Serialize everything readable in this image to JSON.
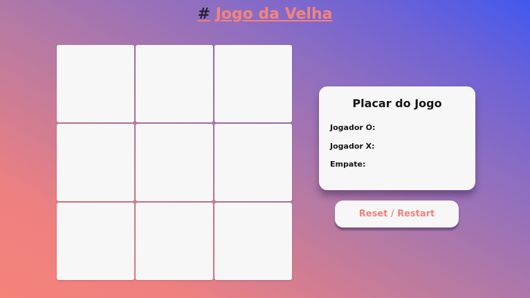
{
  "header": {
    "hash": "#",
    "title": "Jogo da Velha"
  },
  "board": {
    "cells": [
      "",
      "",
      "",
      "",
      "",
      "",
      "",
      "",
      ""
    ]
  },
  "scoreboard": {
    "title": "Placar do Jogo",
    "player_o_label": "Jogador O:",
    "player_o_value": "",
    "player_x_label": "Jogador X:",
    "player_x_value": "",
    "draw_label": "Empate:",
    "draw_value": ""
  },
  "actions": {
    "reset_label": "Reset / Restart"
  },
  "colors": {
    "accent": "#f6837b",
    "panel": "#f7f7f7",
    "gradient_start": "#f5837a",
    "gradient_end": "#4258ee"
  }
}
